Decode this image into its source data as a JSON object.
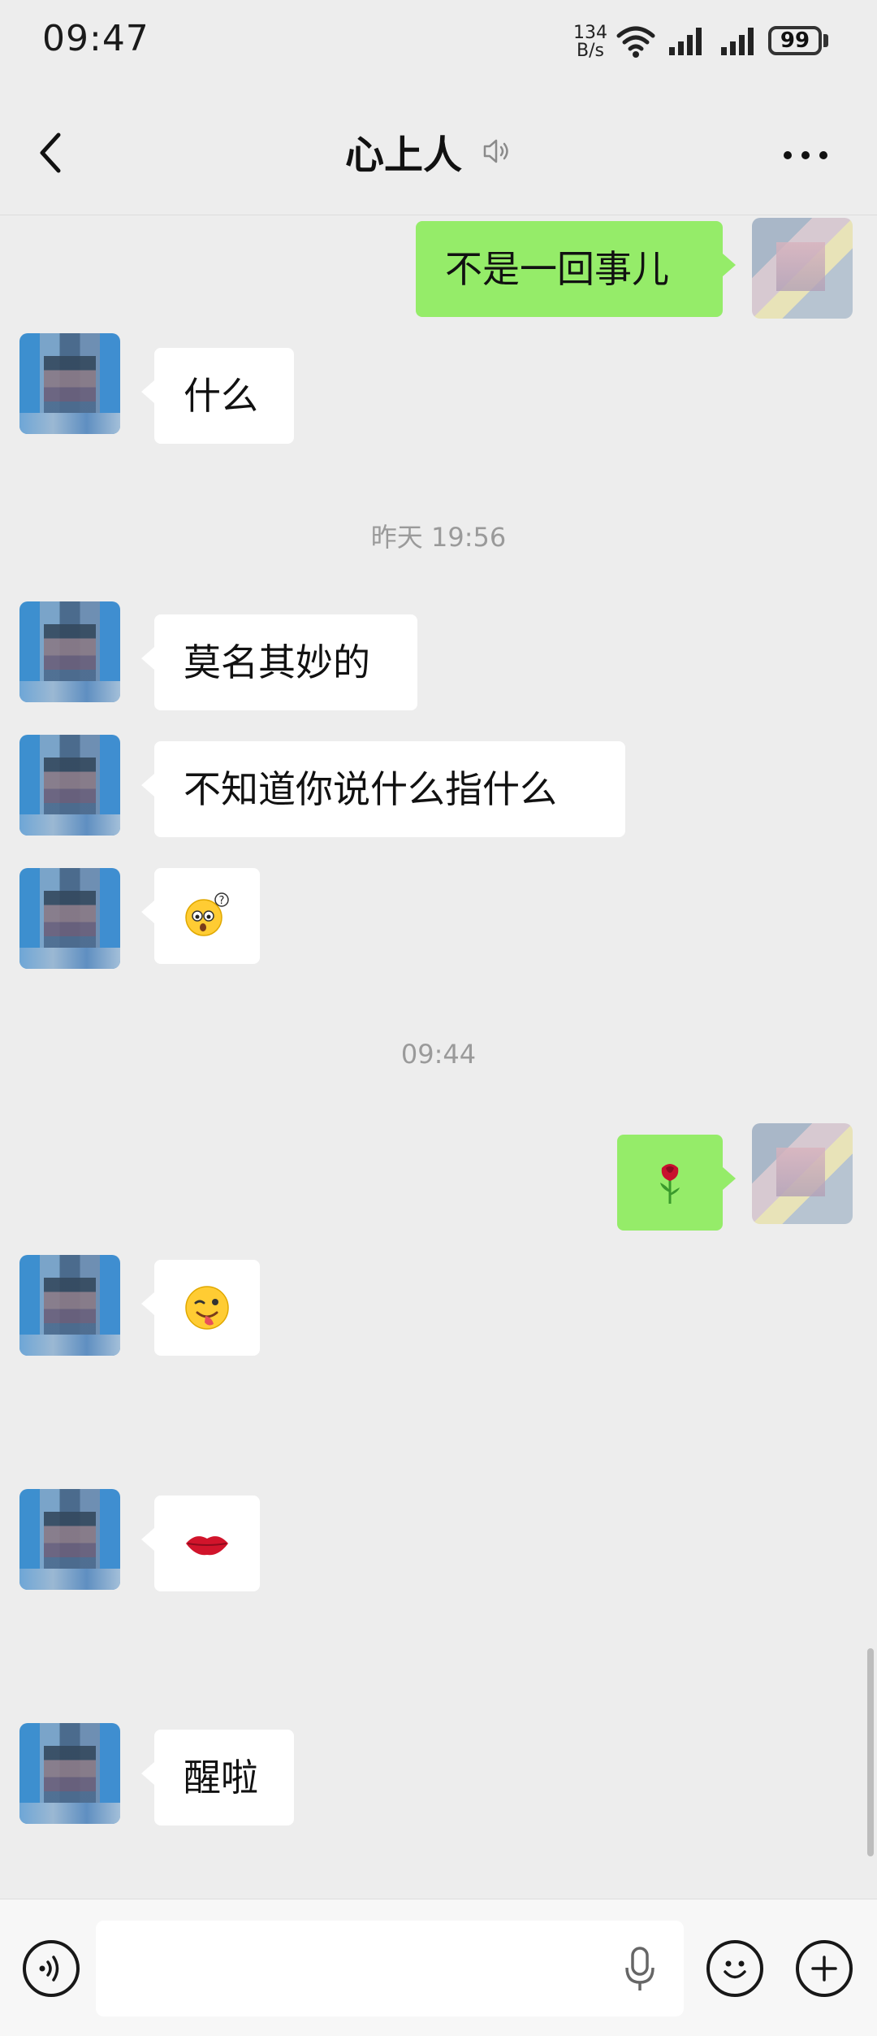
{
  "status_bar": {
    "time": "09:47",
    "net_speed_value": "134",
    "net_speed_unit": "B/s",
    "battery": "99"
  },
  "header": {
    "title": "心上人",
    "icons": [
      "back-icon",
      "mute-icon",
      "more-icon"
    ]
  },
  "messages": [
    {
      "side": "right",
      "type": "text",
      "text": "不是一回事儿"
    },
    {
      "side": "left",
      "type": "text",
      "text": "什么"
    },
    {
      "type": "timestamp",
      "text": "昨天 19:56"
    },
    {
      "side": "left",
      "type": "text",
      "text": "莫名其妙的"
    },
    {
      "side": "left",
      "type": "text",
      "text": "不知道你说什么指什么"
    },
    {
      "side": "left",
      "type": "emoji",
      "emoji": "confused-face-icon"
    },
    {
      "type": "timestamp",
      "text": "09:44"
    },
    {
      "side": "right",
      "type": "emoji",
      "emoji": "rose-icon"
    },
    {
      "side": "left",
      "type": "emoji",
      "emoji": "wink-tongue-face-icon"
    },
    {
      "side": "left",
      "type": "emoji",
      "emoji": "lips-icon"
    },
    {
      "side": "left",
      "type": "text",
      "text": "醒啦"
    }
  ],
  "input_bar": {
    "placeholder": "",
    "icons": [
      "voice-toggle-icon",
      "microphone-icon",
      "emoji-icon",
      "plus-icon"
    ]
  },
  "colors": {
    "background": "#ededed",
    "bubble_right": "#95ec69",
    "bubble_left": "#ffffff",
    "timestamp": "#9a9a9a"
  }
}
